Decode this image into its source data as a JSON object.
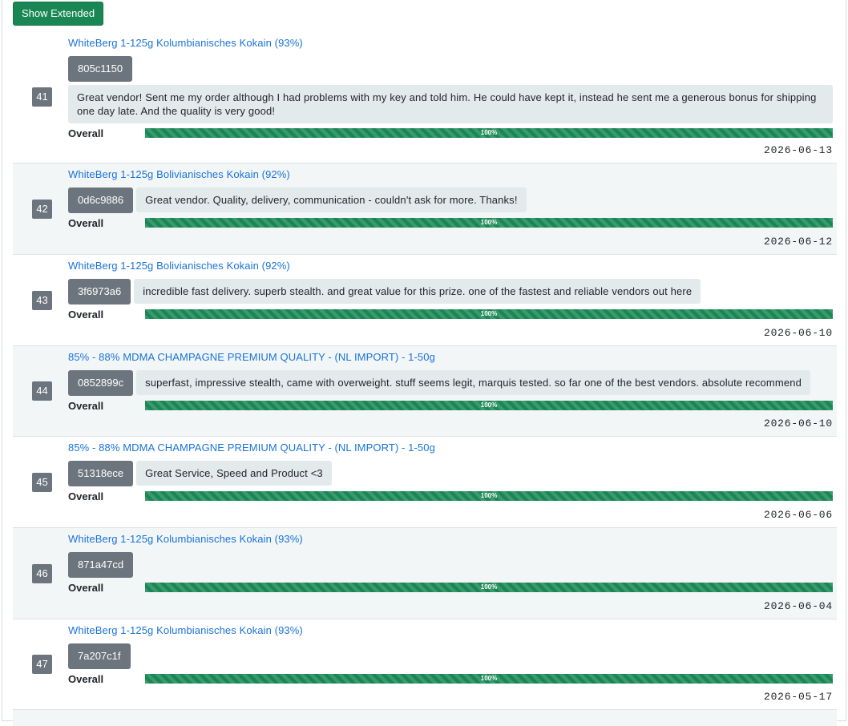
{
  "controls": {
    "toggle_label": "Show Extended"
  },
  "rating_label": "Overall",
  "reviews": [
    {
      "num": "41",
      "title": "WhiteBerg 1-125g Kolumbianisches Kokain (93%)",
      "hash": "805c1150",
      "comment": "Great vendor! Sent me my order although I had problems with my key and told him. He could have kept it, instead he sent me a generous bonus for shipping one day late. And the quality is very good!",
      "rating": 100,
      "rating_text": "100%",
      "date": "2026-06-13"
    },
    {
      "num": "42",
      "title": "WhiteBerg 1-125g Bolivianisches Kokain (92%)",
      "hash": "0d6c9886",
      "comment": "Great vendor. Quality, delivery, communication - couldn't ask for more. Thanks!",
      "rating": 100,
      "rating_text": "100%",
      "date": "2026-06-12"
    },
    {
      "num": "43",
      "title": "WhiteBerg 1-125g Bolivianisches Kokain (92%)",
      "hash": "3f6973a6",
      "comment": "incredible fast delivery. superb stealth. and great value for this prize. one of the fastest and reliable vendors out here",
      "rating": 100,
      "rating_text": "100%",
      "date": "2026-06-10"
    },
    {
      "num": "44",
      "title": "85% - 88% MDMA CHAMPAGNE PREMIUM QUALITY - (NL IMPORT) - 1-50g",
      "hash": "0852899c",
      "comment": "superfast, impressive stealth, came with overweight. stuff seems legit, marquis tested. so far one of the best vendors. absolute recommend",
      "rating": 100,
      "rating_text": "100%",
      "date": "2026-06-10"
    },
    {
      "num": "45",
      "title": "85% - 88% MDMA CHAMPAGNE PREMIUM QUALITY - (NL IMPORT) - 1-50g",
      "hash": "51318ece",
      "comment": "Great Service, Speed and Product <3",
      "rating": 100,
      "rating_text": "100%",
      "date": "2026-06-06"
    },
    {
      "num": "46",
      "title": "WhiteBerg 1-125g Kolumbianisches Kokain (93%)",
      "hash": "871a47cd",
      "comment": "",
      "rating": 100,
      "rating_text": "100%",
      "date": "2026-06-04"
    },
    {
      "num": "47",
      "title": "WhiteBerg 1-125g Kolumbianisches Kokain (93%)",
      "hash": "7a207c1f",
      "comment": "",
      "rating": 100,
      "rating_text": "100%",
      "date": "2026-05-17"
    }
  ]
}
